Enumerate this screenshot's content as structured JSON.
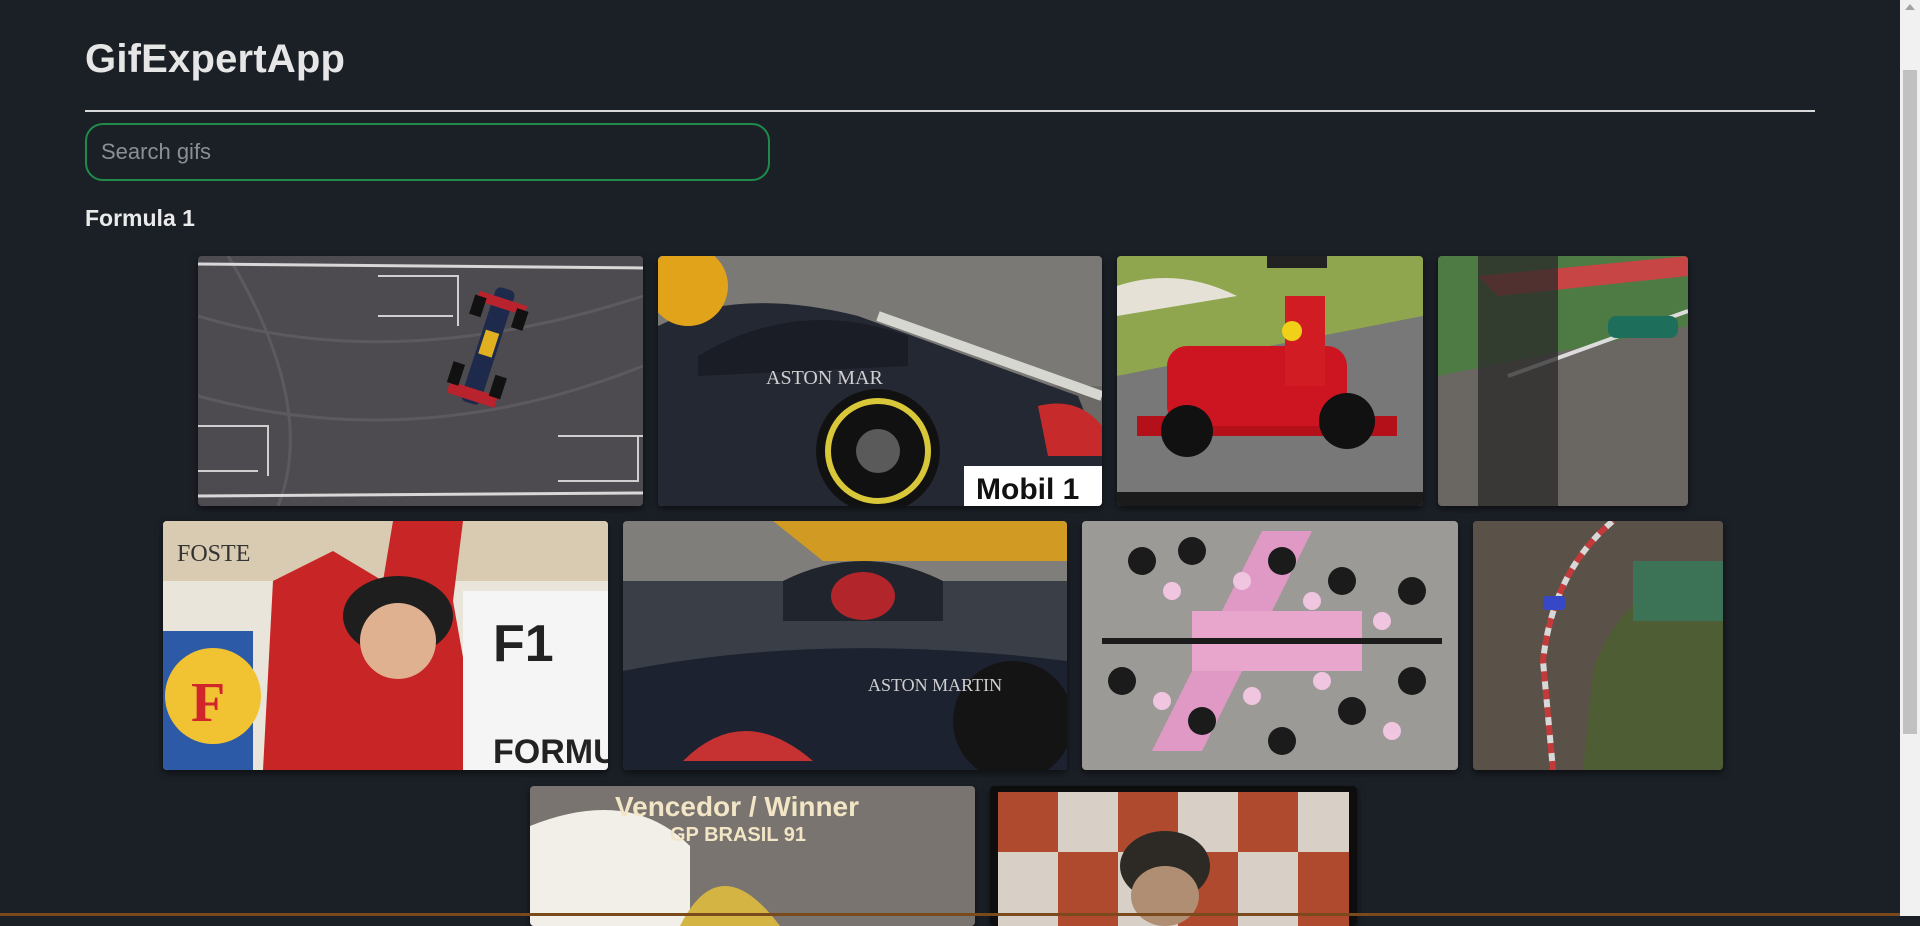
{
  "app": {
    "title": "GifExpertApp"
  },
  "search": {
    "placeholder": "Search gifs",
    "value": ""
  },
  "categories": [
    {
      "name": "Formula 1",
      "gifs": [
        {
          "caption": "Red Bull car drifting on tarmac, aerial view"
        },
        {
          "caption": "Red Bull car close-up",
          "text": [
            "ASTON MAR",
            "Mobil 1"
          ]
        },
        {
          "caption": "Ferrari car on track"
        },
        {
          "caption": "Mercedes car blurred motion"
        },
        {
          "caption": "Driver celebrating on podium",
          "text": [
            "FOSTE",
            "F",
            "FORMUL"
          ]
        },
        {
          "caption": "Red Bull car with driver",
          "text": [
            "ASTON MARTIN"
          ]
        },
        {
          "caption": "Pit stop aerial view"
        },
        {
          "caption": "Car racing around a corner, aerial"
        },
        {
          "caption": "Vencedor / Winner GP Brasil 91",
          "text": [
            "Vencedor / Winner",
            "GP BRASIL 91"
          ]
        },
        {
          "caption": "Driver on podium, vintage footage"
        }
      ]
    }
  ],
  "colors": {
    "background": "#1b2027",
    "search_border": "#1f8a4a",
    "text": "#e6e6e6"
  }
}
